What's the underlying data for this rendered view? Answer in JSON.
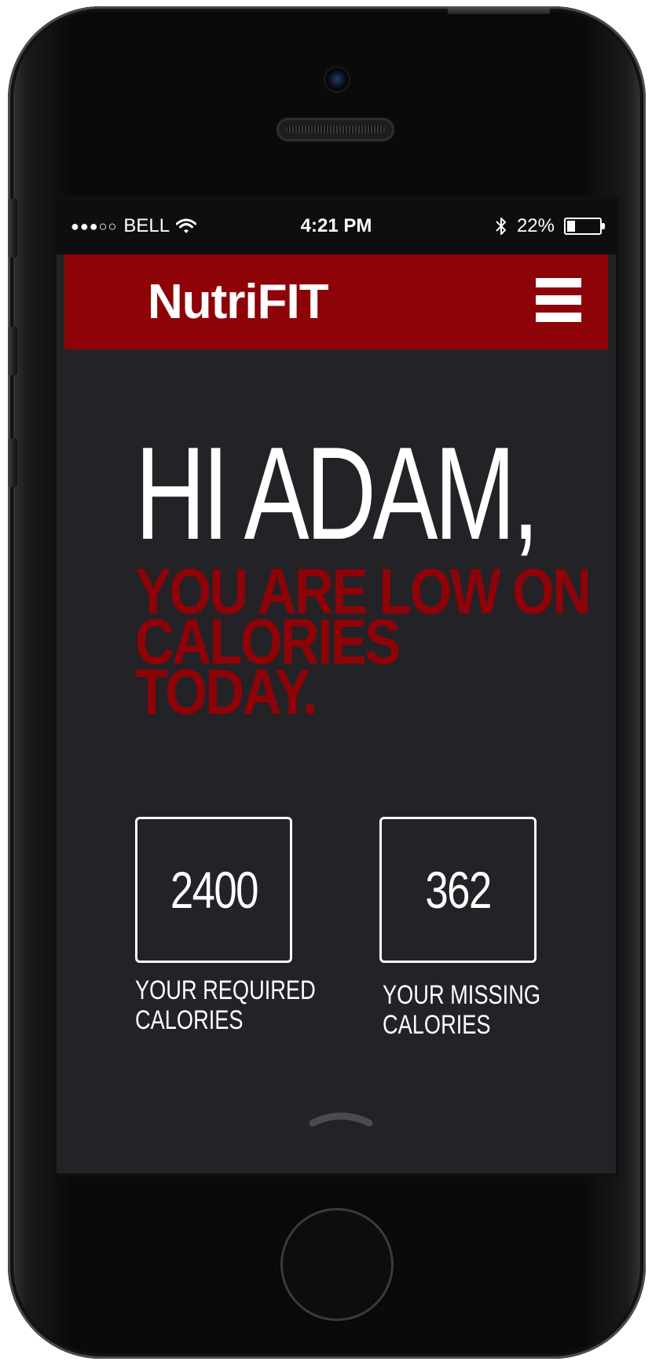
{
  "status_bar": {
    "signal": "●●●○○",
    "carrier": "BELL",
    "time": "4:21 PM",
    "battery": "22%",
    "battery_level": 0.22,
    "icons": [
      "wifi-icon",
      "bluetooth-icon",
      "battery-icon"
    ]
  },
  "header": {
    "app_name": "NutriFIT",
    "menu_icon": "hamburger-menu-icon",
    "background_color": "#8e0307"
  },
  "main": {
    "greeting": "HI ADAM,",
    "message_lines": [
      "YOU ARE LOW ON",
      "CALORIES",
      "TODAY."
    ],
    "accent_color": "#8e0307",
    "background_color": "#232226"
  },
  "stats": [
    {
      "value": "2400",
      "label_lines": [
        "YOUR REQUIRED",
        "CALORIES"
      ]
    },
    {
      "value": "362",
      "label_lines": [
        "YOUR MISSING",
        "CALORIES"
      ]
    }
  ],
  "footer": {
    "swipe_icon": "chevron-up-icon"
  }
}
